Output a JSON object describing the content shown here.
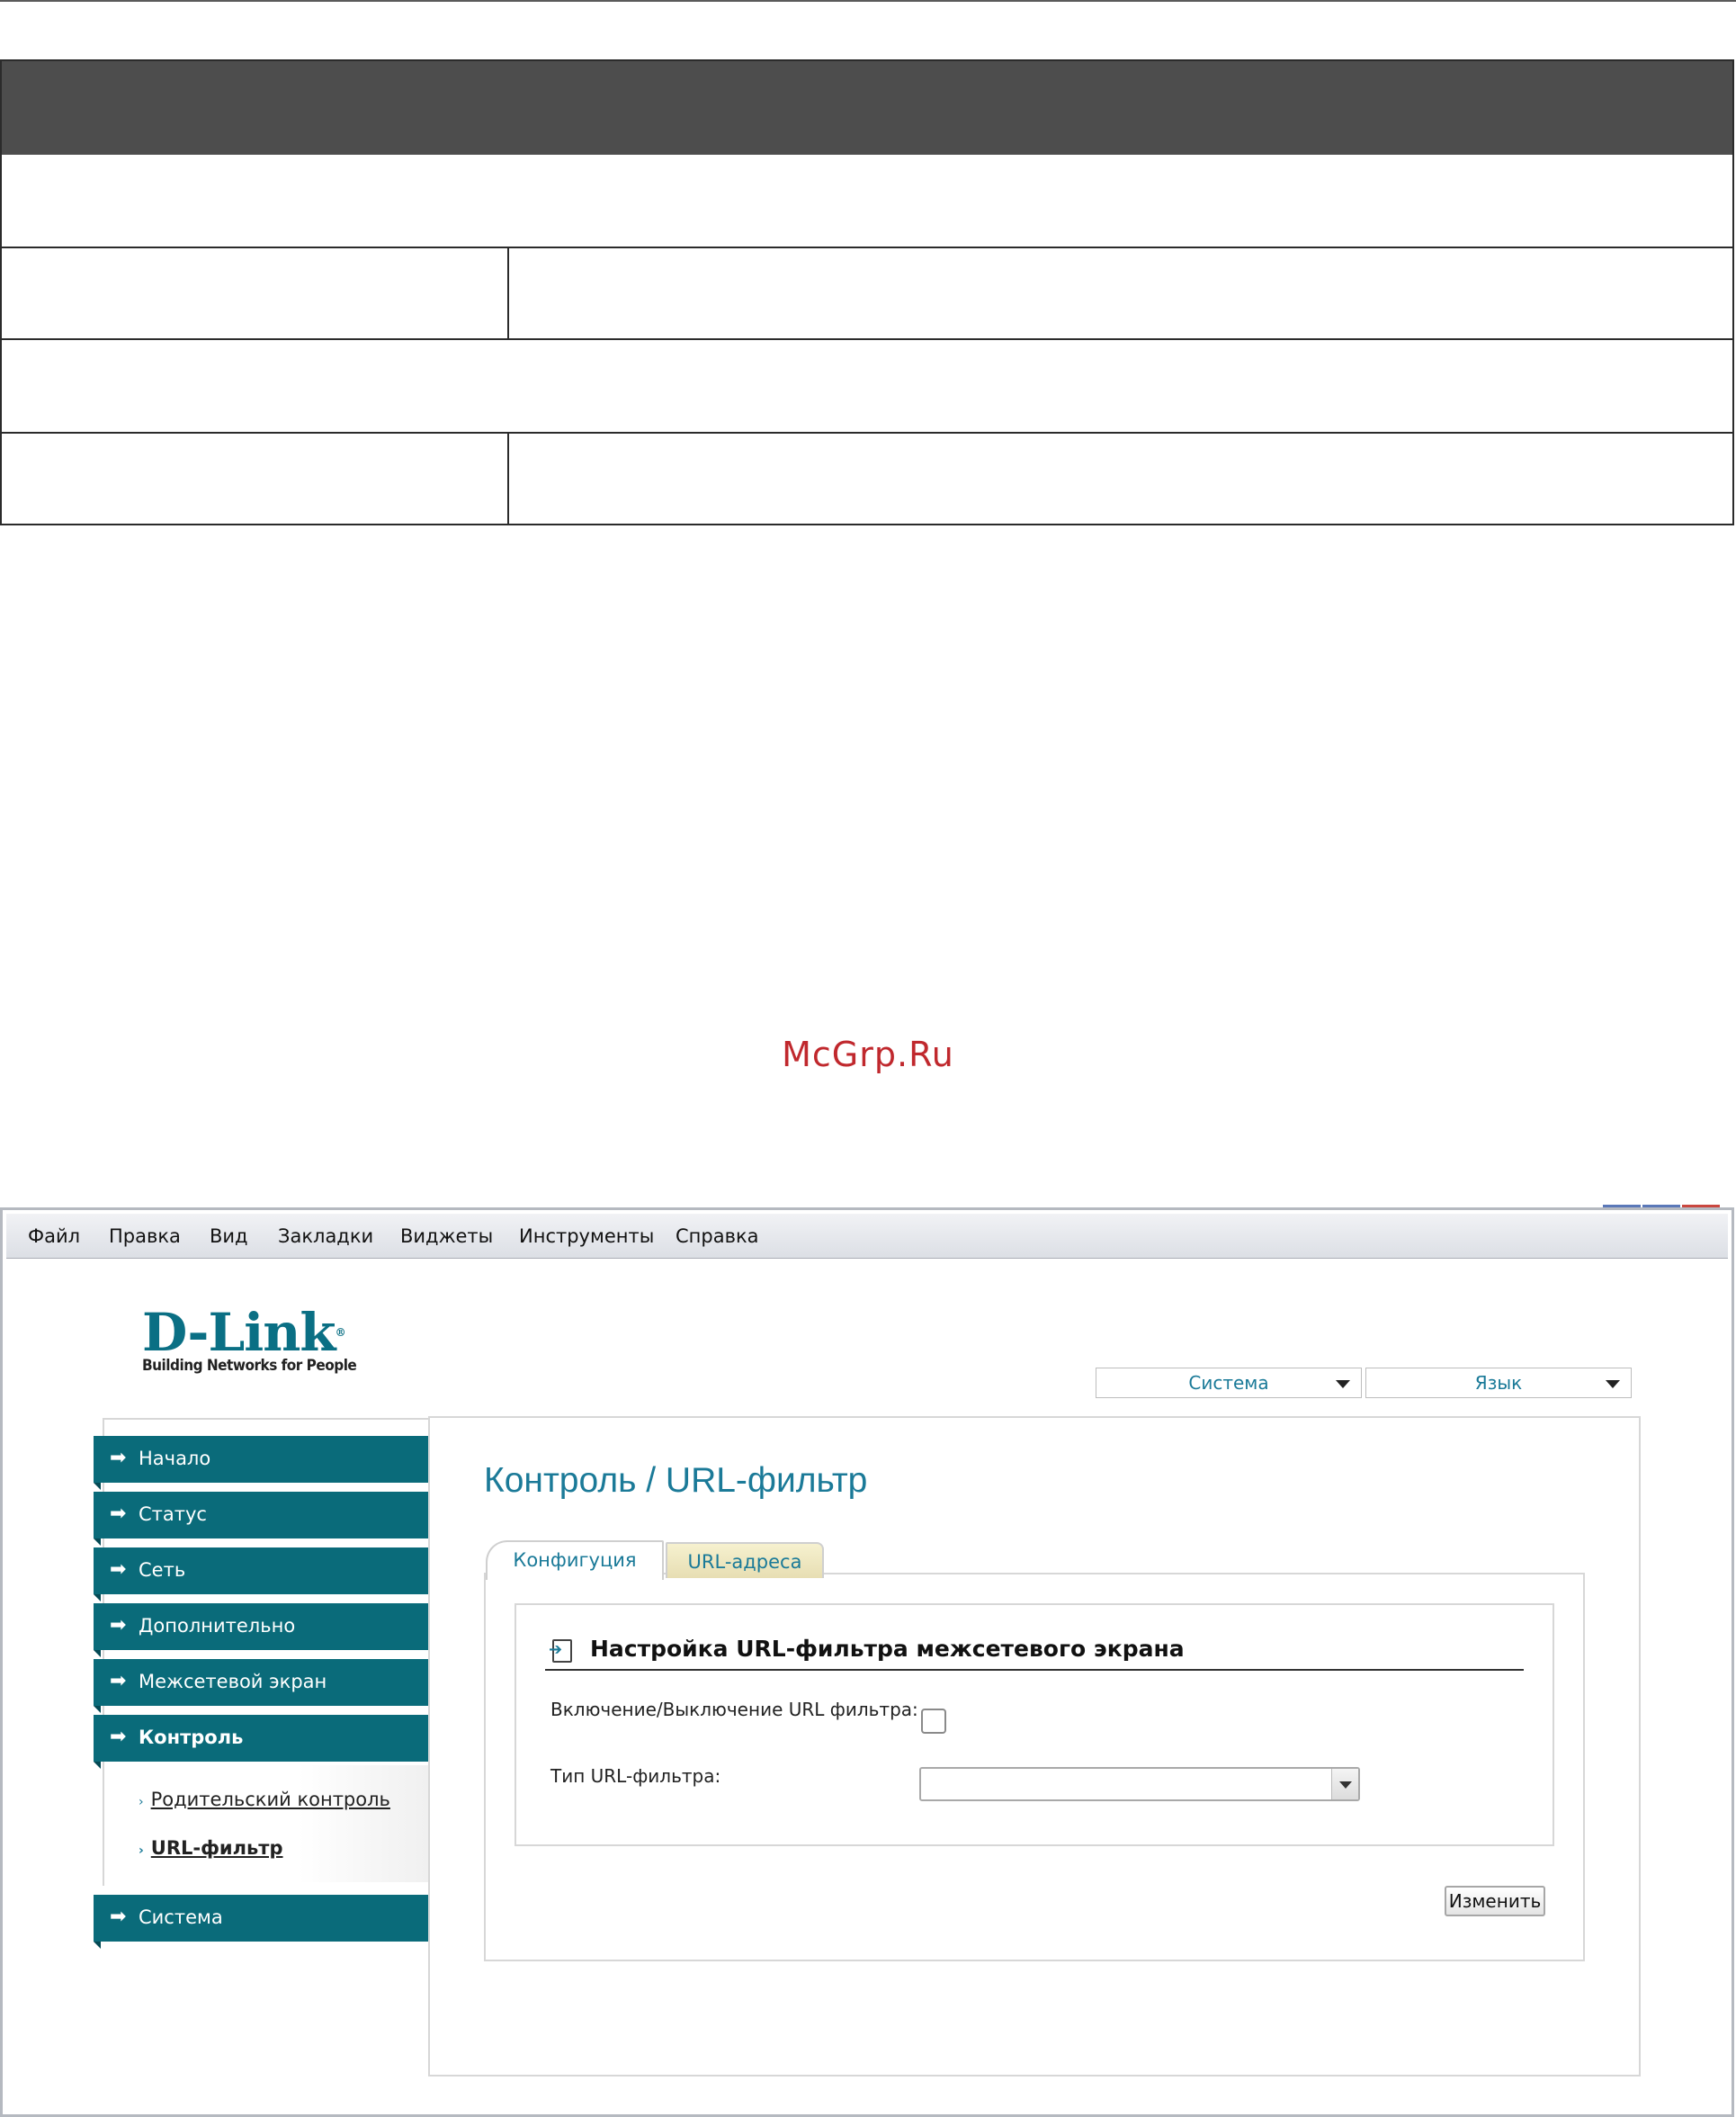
{
  "watermark": "McGrp.Ru",
  "browser": {
    "menu": [
      "Файл",
      "Правка",
      "Вид",
      "Закладки",
      "Виджеты",
      "Инструменты",
      "Справка"
    ]
  },
  "logo": {
    "brand": "D-Link",
    "tagline": "Building Networks for People",
    "registered": "®"
  },
  "top_dropdowns": {
    "system": "Система",
    "language": "Язык"
  },
  "sidebar": {
    "items": [
      {
        "label": "Начало"
      },
      {
        "label": "Статус"
      },
      {
        "label": "Сеть"
      },
      {
        "label": "Дополнительно"
      },
      {
        "label": "Межсетевой экран"
      },
      {
        "label": "Контроль"
      },
      {
        "label": "Система"
      }
    ],
    "subitems": [
      {
        "label": "Родительский контроль"
      },
      {
        "label": "URL-фильтр"
      }
    ],
    "active_item": "Контроль",
    "active_subitem": "URL-фильтр"
  },
  "main": {
    "title": "Контроль / URL-фильтр",
    "tabs": [
      {
        "label": "Конфигуция"
      },
      {
        "label": "URL-адреса"
      }
    ],
    "active_tab": "Конфигуция",
    "section_title": "Настройка URL-фильтра межсетевого экрана",
    "fields": {
      "enable_label": "Включение/Выключение URL фильтра:",
      "enable_checked": false,
      "type_label": "Тип URL-фильтра:",
      "type_value": ""
    },
    "apply_label": "Изменить"
  },
  "colors": {
    "accent": "#0a6b7a",
    "link": "#1a7a98",
    "brand": "#0a6f84",
    "watermark": "#c0282d",
    "doc_header": "#4d4d4d"
  }
}
